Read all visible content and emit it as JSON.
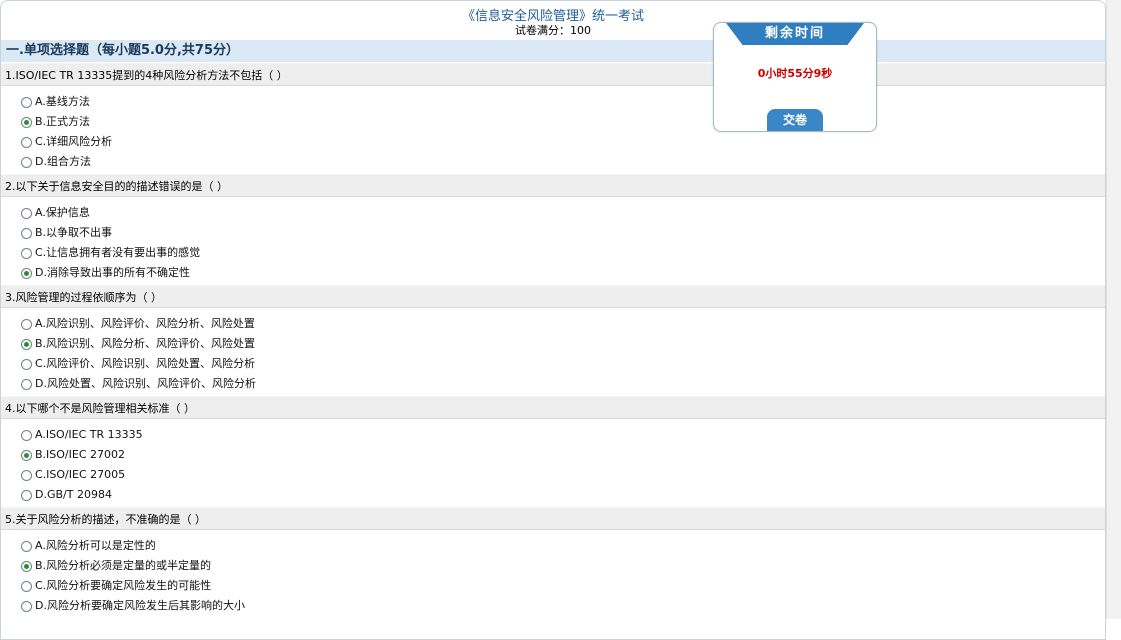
{
  "exam": {
    "title": "《信息安全风险管理》统一考试",
    "score": "试卷满分：100"
  },
  "section_title": "一.单项选择题（每小题5.0分,共75分）",
  "timer": {
    "label": "剩余时间",
    "remaining": "0小时55分9秒",
    "submit_label": "交卷"
  },
  "questions": [
    {
      "text": "1.ISO/IEC TR 13335提到的4种风险分析方法不包括（ ）",
      "options": [
        "A.基线方法",
        "B.正式方法",
        "C.详细风险分析",
        "D.组合方法"
      ],
      "selected": 1
    },
    {
      "text": "2.以下关于信息安全目的的描述错误的是（ ）",
      "options": [
        "A.保护信息",
        "B.以争取不出事",
        "C.让信息拥有者没有要出事的感觉",
        "D.消除导致出事的所有不确定性"
      ],
      "selected": 3
    },
    {
      "text": "3.风险管理的过程依顺序为（ ）",
      "options": [
        "A.风险识别、风险评价、风险分析、风险处置",
        "B.风险识别、风险分析、风险评价、风险处置",
        "C.风险评价、风险识别、风险处置、风险分析",
        "D.风险处置、风险识别、风险评价、风险分析"
      ],
      "selected": 1
    },
    {
      "text": "4.以下哪个不是风险管理相关标准（ ）",
      "options": [
        "A.ISO/IEC TR 13335",
        "B.ISO/IEC 27002",
        "C.ISO/IEC 27005",
        "D.GB/T 20984"
      ],
      "selected": 1
    },
    {
      "text": "5.关于风险分析的描述，不准确的是（ ）",
      "options": [
        "A.风险分析可以是定性的",
        "B.风险分析必须是定量的或半定量的",
        "C.风险分析要确定风险发生的可能性",
        "D.风险分析要确定风险发生后其影响的大小"
      ],
      "selected": 1
    }
  ]
}
